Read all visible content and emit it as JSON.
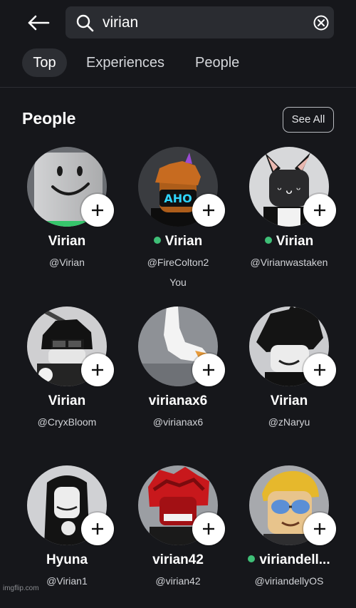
{
  "header": {
    "back_icon": "arrow-left-icon",
    "search_icon": "search-icon",
    "clear_icon": "clear-circle-x-icon",
    "search_value": "virian"
  },
  "tabs": [
    {
      "label": "Top",
      "selected": true
    },
    {
      "label": "Experiences",
      "selected": false
    },
    {
      "label": "People",
      "selected": false
    }
  ],
  "section": {
    "title": "People",
    "see_all_label": "See All"
  },
  "people": [
    {
      "name": "Virian",
      "handle": "@Virian",
      "online": false,
      "sub": ""
    },
    {
      "name": "Virian",
      "handle": "@FireColton2",
      "online": true,
      "sub": "You"
    },
    {
      "name": "Virian",
      "handle": "@Virianwastaken",
      "online": true,
      "sub": ""
    },
    {
      "name": "Virian",
      "handle": "@CryxBloom",
      "online": false,
      "sub": ""
    },
    {
      "name": "virianax6",
      "handle": "@virianax6",
      "online": false,
      "sub": ""
    },
    {
      "name": "Virian",
      "handle": "@zNaryu",
      "online": false,
      "sub": ""
    },
    {
      "name": "Hyuna",
      "handle": "@Virian1",
      "online": false,
      "sub": ""
    },
    {
      "name": "virian42",
      "handle": "@virian42",
      "online": false,
      "sub": ""
    },
    {
      "name": "viriandell...",
      "handle": "@viriandellyOS",
      "online": true,
      "sub": ""
    }
  ],
  "colors": {
    "background": "#16171b",
    "online": "#3fbf77",
    "tab_selected_bg": "#2c2e33"
  },
  "watermark": "imgflip.com"
}
